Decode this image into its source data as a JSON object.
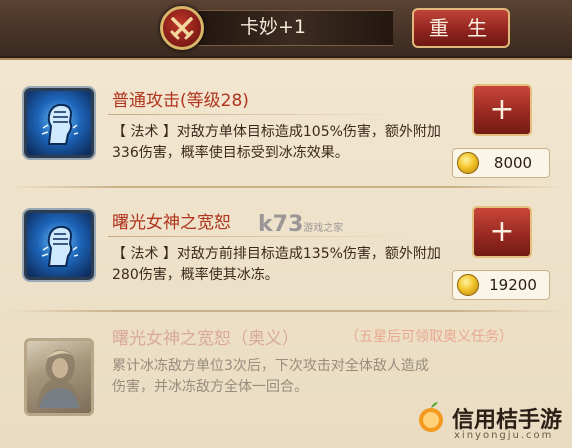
{
  "header": {
    "title": "卡妙+1",
    "rebirth_label": "重 生",
    "emblem_icon": "crossed-swords-icon"
  },
  "skills": [
    {
      "name": "普通攻击(等级28)",
      "description": "【 法术 】对敌方单体目标造成105%伤害，额外附加336伤害，概率使目标受到冰冻效果。",
      "icon": "fist-icon",
      "upgrade_label": "+",
      "cost": "8000"
    },
    {
      "name": "曙光女神之宽恕",
      "description": "【 法术 】对敌方前排目标造成135%伤害，额外附加280伤害，概率使其冰冻。",
      "icon": "fist-icon",
      "upgrade_label": "+",
      "cost": "19200"
    },
    {
      "name": "曙光女神之宽恕（奥义）",
      "hint": "（五星后可领取奥义任务）",
      "description": "累计冰冻敌方单位3次后，下次攻击对全体敌人造成伤害，并冰冻敌方全体一回合。",
      "icon": "character-portrait"
    }
  ],
  "watermark": {
    "brand": "信用桔手游",
    "domain": "xinyongju.com",
    "middle": "k73",
    "middle_sub": "游戏之家"
  },
  "colors": {
    "accent_red": "#b0341e",
    "button_red": "#952720",
    "gold_border": "#e4c07f"
  }
}
